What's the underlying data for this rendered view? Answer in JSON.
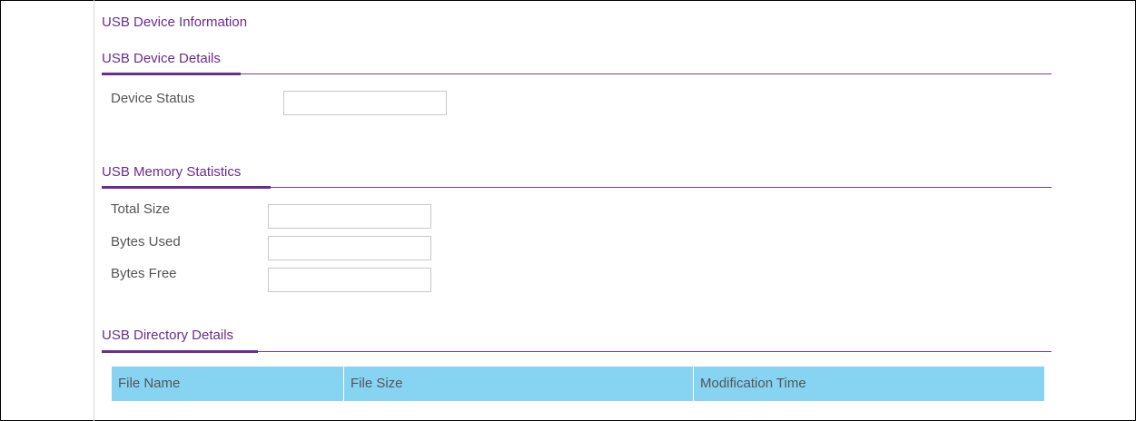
{
  "page_title": "USB Device Information",
  "device_details": {
    "title": "USB Device Details",
    "device_status_label": "Device Status",
    "device_status_value": ""
  },
  "memory_statistics": {
    "title": "USB Memory Statistics",
    "total_size_label": "Total Size",
    "total_size_value": "",
    "bytes_used_label": "Bytes Used",
    "bytes_used_value": "",
    "bytes_free_label": "Bytes Free",
    "bytes_free_value": ""
  },
  "directory_details": {
    "title": "USB Directory Details",
    "columns": [
      "File Name",
      "File Size",
      "Modification Time"
    ],
    "rows": []
  },
  "colors": {
    "heading": "#6a2c91",
    "table_header": "#87d3f2",
    "text": "#555555"
  }
}
